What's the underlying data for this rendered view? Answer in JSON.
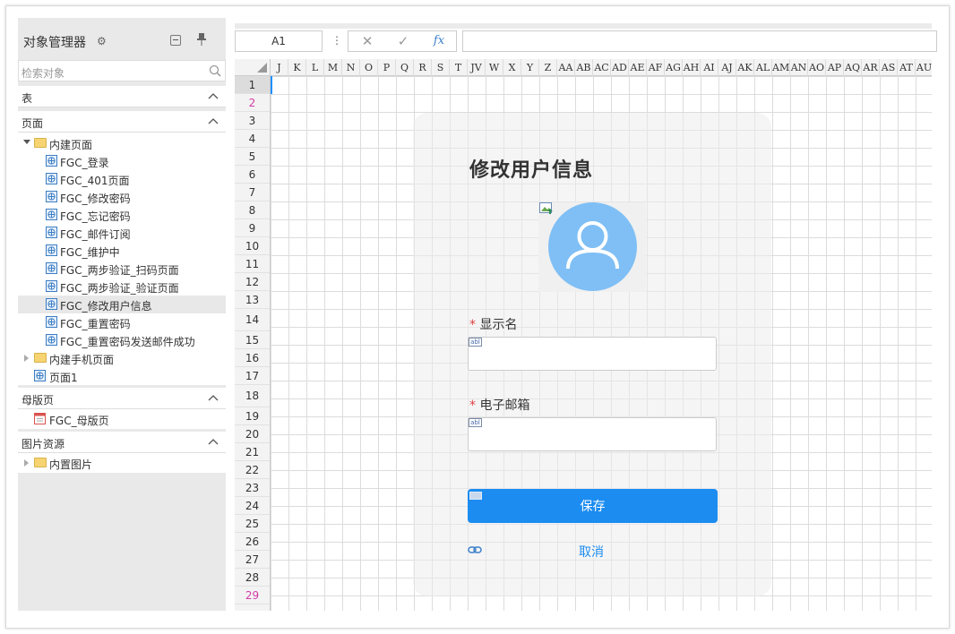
{
  "sidebar": {
    "title": "对象管理器",
    "search_placeholder": "检索对象",
    "sections": {
      "table": "表",
      "pages": "页面",
      "master": "母版页",
      "images": "图片资源"
    },
    "builtin_folder": "内建页面",
    "pages": [
      "FGC_登录",
      "FGC_401页面",
      "FGC_修改密码",
      "FGC_忘记密码",
      "FGC_邮件订阅",
      "FGC_维护中",
      "FGC_两步验证_扫码页面",
      "FGC_两步验证_验证页面",
      "FGC_修改用户信息",
      "FGC_重置密码",
      "FGC_重置密码发送邮件成功"
    ],
    "mobile_folder": "内建手机页面",
    "page1": "页面1",
    "master_item": "FGC_母版页",
    "images_folder": "内置图片"
  },
  "formula_bar": {
    "cell_ref": "A1",
    "fx": "fx"
  },
  "grid": {
    "columns": [
      "J",
      "K",
      "L",
      "M",
      "N",
      "O",
      "P",
      "Q",
      "R",
      "S",
      "T",
      "JV",
      "W",
      "X",
      "Y",
      "Z",
      "AA",
      "AB",
      "AC",
      "AD",
      "AE",
      "AF",
      "AG",
      "AH",
      "AI",
      "AJ",
      "AK",
      "AL",
      "AM",
      "AN",
      "AO",
      "AP",
      "AQ",
      "AR",
      "AS",
      "AT",
      "AU"
    ],
    "rows": [
      "1",
      "2",
      "3",
      "4",
      "5",
      "6",
      "7",
      "8",
      "9",
      "10",
      "11",
      "12",
      "13",
      "14",
      "15",
      "16",
      "17",
      "18",
      "19",
      "20",
      "21",
      "22",
      "23",
      "24",
      "25",
      "26",
      "27",
      "28",
      "29"
    ]
  },
  "form": {
    "title": "修改用户信息",
    "required_mark": "*",
    "display_name_label": "显示名",
    "email_label": "电子邮箱",
    "abl": "abl",
    "save_label": "保存",
    "cancel_label": "取消"
  },
  "colors": {
    "accent": "#1c8cf0",
    "avatar": "#7fbff5",
    "row_marker": "#d23ca6"
  }
}
